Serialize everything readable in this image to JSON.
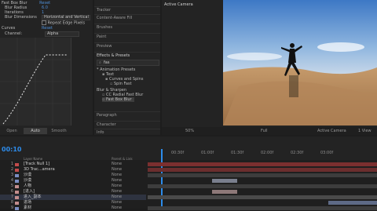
{
  "effect_controls": {
    "title": "Fast Box Blur",
    "reset": "Reset",
    "radius_label": "Blur Radius",
    "radius_value": "6.0",
    "iterations_label": "Iterations",
    "iterations_value": "1",
    "dimensions_label": "Blur Dimensions",
    "dimensions_value": "Horizontal and Vertical",
    "repeat_edge": "Repeat Edge Pixels",
    "curves_label": "Curves",
    "curves_reset": "Reset",
    "channel_label": "Channel:",
    "channel_value": "Alpha",
    "buttons": [
      "Open",
      "Auto",
      "Smooth"
    ]
  },
  "panels": {
    "tracker": "Tracker",
    "content_aware": "Content-Aware Fill",
    "brushes": "Brushes",
    "paint": "Paint",
    "preview": "Preview",
    "effects_presets": "Effects & Presets",
    "search_value": "fas",
    "tree": [
      "* Animation Presets",
      "Text",
      "Curves and Spins",
      "Spin Fast",
      "Blur & Sharpen",
      "CC Radial Fast Blur",
      "Fast Box Blur"
    ],
    "paragraph": "Paragraph",
    "character": "Character",
    "info": "Info"
  },
  "viewer": {
    "title": "Active Camera",
    "zoom": "50%",
    "quality": "Full",
    "camera": "Active Camera",
    "views": "1 View"
  },
  "timeline": {
    "timecode": "00:10",
    "ruler": [
      "00:30f",
      "01:00f",
      "01:30f",
      "02:00f",
      "02:30f",
      "03:00f"
    ],
    "col_layer_name": "Layer Name",
    "col_parent": "Parent & Link",
    "layers": [
      {
        "num": "1",
        "name": "[Track Null 1]",
        "parent": "None",
        "color": "#c24b4b"
      },
      {
        "num": "2",
        "name": "3D Trac...amera",
        "parent": "None",
        "color": "#c24b4b"
      },
      {
        "num": "3",
        "name": "沙漠",
        "parent": "None",
        "color": "#7a8dc2"
      },
      {
        "num": "4",
        "name": "沙漠",
        "parent": "None",
        "color": "#7a8dc2"
      },
      {
        "num": "5",
        "name": "人物",
        "parent": "None",
        "color": "#c28d8d"
      },
      {
        "num": "6",
        "name": "[进入]",
        "parent": "None",
        "color": "#c28d8d"
      },
      {
        "num": "7",
        "name": "进入_副本",
        "parent": "None",
        "color": "#c28d8d"
      },
      {
        "num": "8",
        "name": "进场",
        "parent": "None",
        "color": "#c28d8d"
      },
      {
        "num": "9",
        "name": "素材",
        "parent": "None",
        "color": "#7a8dc2"
      }
    ]
  },
  "colors": {
    "accent": "#2d8ceb",
    "track_red": "#7b2f2f",
    "track_blue": "#4a5a7a",
    "track_pink": "#7a6060"
  }
}
